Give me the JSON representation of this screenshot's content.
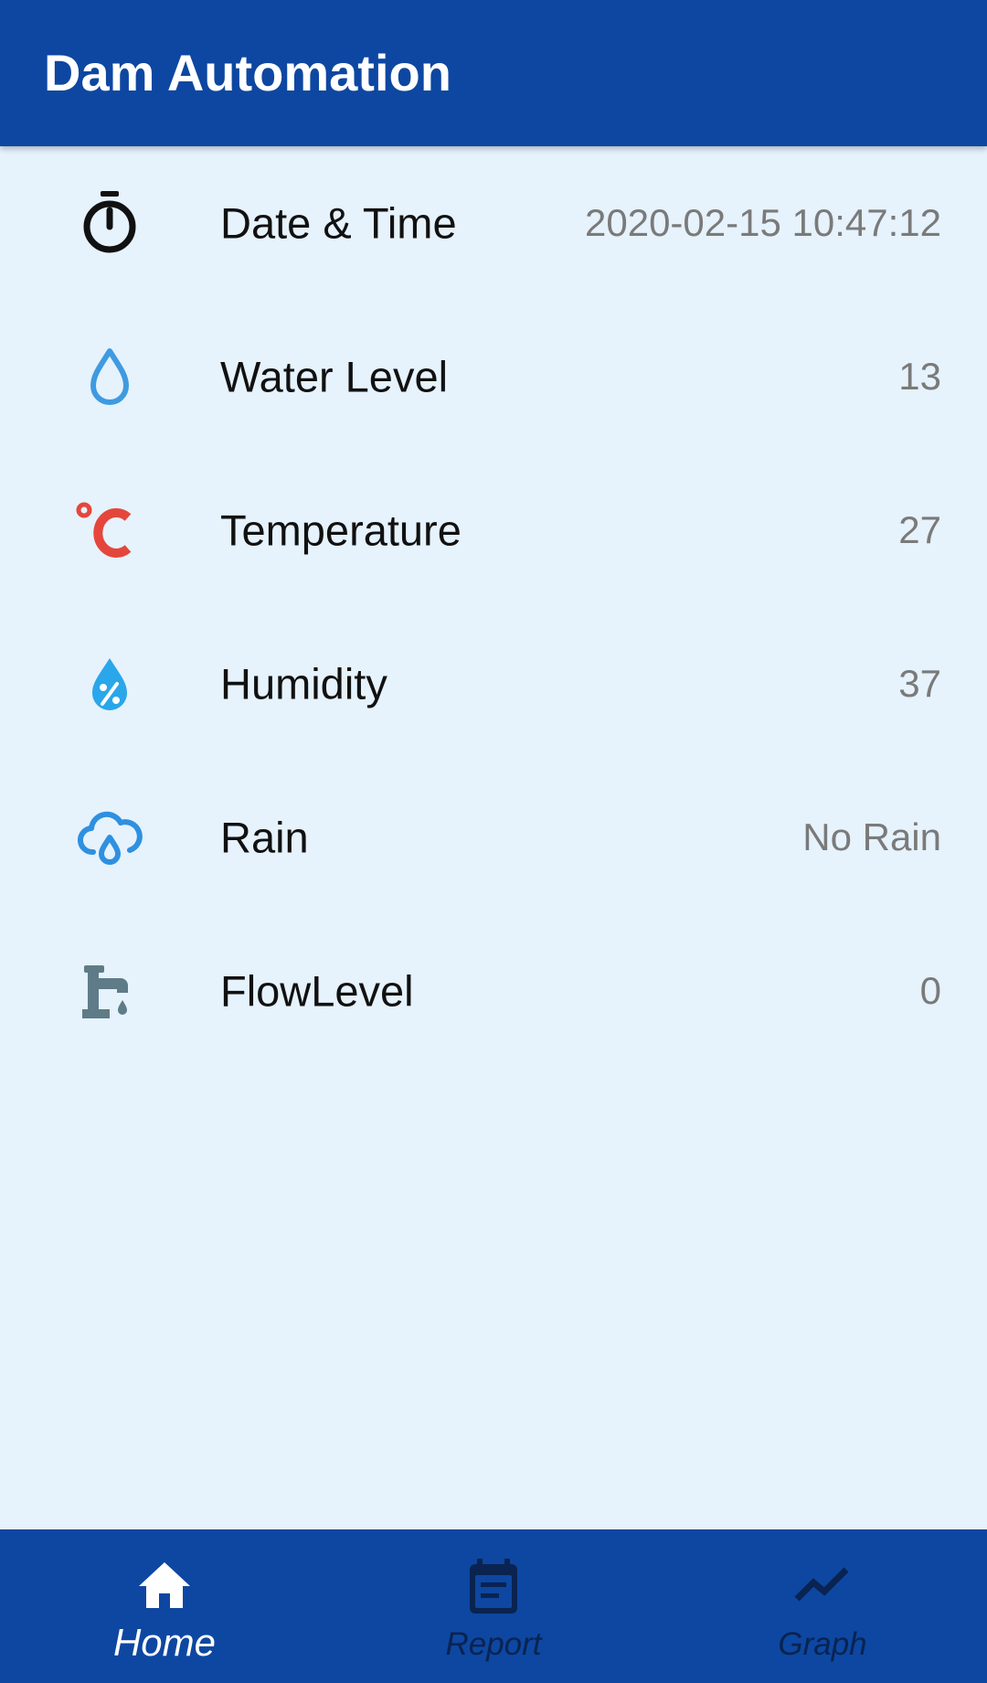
{
  "app": {
    "title": "Dam Automation"
  },
  "readings": [
    {
      "label": "Date & Time",
      "value": "2020-02-15 10:47:12",
      "icon": "stopwatch-icon",
      "color": "#111111"
    },
    {
      "label": "Water Level",
      "value": "13",
      "icon": "water-drop-icon",
      "color": "#3f9ae0"
    },
    {
      "label": "Temperature",
      "value": "27",
      "icon": "celsius-icon",
      "color": "#e5463c"
    },
    {
      "label": "Humidity",
      "value": "37",
      "icon": "humidity-icon",
      "color": "#2aa6ea"
    },
    {
      "label": "Rain",
      "value": "No Rain",
      "icon": "rain-cloud-icon",
      "color": "#2e90e0"
    },
    {
      "label": "FlowLevel",
      "value": "0",
      "icon": "water-tap-icon",
      "color": "#5f7b88"
    }
  ],
  "bottom_nav": {
    "items": [
      {
        "label": "Home",
        "icon": "home-icon",
        "active": true
      },
      {
        "label": "Report",
        "icon": "report-icon",
        "active": false
      },
      {
        "label": "Graph",
        "icon": "graph-icon",
        "active": false
      }
    ]
  },
  "colors": {
    "primary": "#0d47a1",
    "background": "#e6f2fc",
    "value_text": "#7a7a7a",
    "nav_inactive": "#0a2350"
  }
}
